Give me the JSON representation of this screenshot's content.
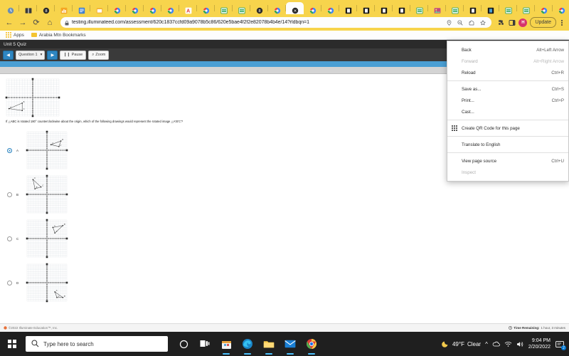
{
  "browser": {
    "tabs": [
      {
        "name": "tab-1",
        "icon": "clock-icon",
        "active": false
      },
      {
        "name": "tab-2",
        "icon": "book-icon",
        "active": false
      },
      {
        "name": "tab-3",
        "icon": "circle-8-icon",
        "active": false
      },
      {
        "name": "tab-4",
        "icon": "chart-icon",
        "active": false
      },
      {
        "name": "tab-5",
        "icon": "document-icon",
        "active": false
      },
      {
        "name": "tab-6",
        "icon": "window-icon",
        "active": false
      },
      {
        "name": "tab-7",
        "icon": "google-icon",
        "active": false
      },
      {
        "name": "tab-8",
        "icon": "google-icon",
        "active": false
      },
      {
        "name": "tab-9",
        "icon": "google-icon",
        "active": false
      },
      {
        "name": "tab-10",
        "icon": "google-icon",
        "active": false
      },
      {
        "name": "tab-11",
        "icon": "a-plus-icon",
        "active": false
      },
      {
        "name": "tab-12",
        "icon": "google-icon",
        "active": false
      },
      {
        "name": "tab-13",
        "icon": "spreadsheet-icon",
        "active": false
      },
      {
        "name": "tab-14",
        "icon": "spreadsheet-icon",
        "active": false
      },
      {
        "name": "tab-15",
        "icon": "circle-8-icon",
        "active": false
      },
      {
        "name": "tab-16",
        "icon": "google-icon",
        "active": false
      },
      {
        "name": "tab-17",
        "icon": "illuminate-icon",
        "active": true
      },
      {
        "name": "tab-18",
        "icon": "google-icon",
        "active": false
      },
      {
        "name": "tab-19",
        "icon": "google-icon",
        "active": false
      },
      {
        "name": "tab-20",
        "icon": "dark-doc-icon",
        "active": false
      },
      {
        "name": "tab-21",
        "icon": "dark-doc-icon",
        "active": false
      },
      {
        "name": "tab-22",
        "icon": "dark-doc-icon",
        "active": false
      },
      {
        "name": "tab-23",
        "icon": "dark-doc-icon",
        "active": false
      },
      {
        "name": "tab-24",
        "icon": "spreadsheet-icon",
        "active": false
      },
      {
        "name": "tab-25",
        "icon": "photo-icon",
        "active": false
      },
      {
        "name": "tab-26",
        "icon": "spreadsheet-icon",
        "active": false
      },
      {
        "name": "tab-27",
        "icon": "dark-doc-icon",
        "active": false
      },
      {
        "name": "tab-28",
        "icon": "blue-doc-icon",
        "active": false
      },
      {
        "name": "tab-29",
        "icon": "spreadsheet-icon",
        "active": false
      },
      {
        "name": "tab-30",
        "icon": "spreadsheet-icon",
        "active": false
      },
      {
        "name": "tab-31",
        "icon": "google-icon",
        "active": false
      },
      {
        "name": "tab-32",
        "icon": "google-icon",
        "active": false
      },
      {
        "name": "tab-33",
        "icon": "opera-icon",
        "active": false
      },
      {
        "name": "tab-34",
        "icon": "contact-icon",
        "active": false
      }
    ],
    "new_tab_label": "+",
    "tab_search_label": "⌄",
    "window_controls": {
      "minimize": "—",
      "maximize": "❐",
      "close": "✕"
    },
    "nav": {
      "back": "←",
      "forward": "→",
      "reload": "⟳",
      "home": "⌂"
    },
    "address": {
      "lock_icon": "lock-icon",
      "url": "testing.illuminateed.com/assessment/620c1837ccfd09a9078b5c86/620e5bae4f2f2e82078b4b4e/14?rldbqn=1"
    },
    "omni_icons": [
      "location-pin-icon",
      "zoom-out-icon",
      "share-icon",
      "bookmark-star-icon"
    ],
    "toolbar_right": {
      "extensions_icon": "puzzle-icon",
      "sidepanel_icon": "sidepanel-icon",
      "avatar_initial": "H",
      "update_label": "Update",
      "menu_icon": "kebab-menu-icon"
    },
    "bookmarks": [
      {
        "label": "Apps",
        "icon": "apps-grid-icon"
      },
      {
        "label": "Arabia Mtn Bookmarks",
        "icon": "folder-icon"
      }
    ],
    "theme_color": "#f7d44c"
  },
  "context_menu": {
    "groups": [
      [
        {
          "label": "Back",
          "accel": "Alt+Left Arrow",
          "disabled": false,
          "name": "ctx-back"
        },
        {
          "label": "Forward",
          "accel": "Alt+Right Arrow",
          "disabled": true,
          "name": "ctx-forward"
        },
        {
          "label": "Reload",
          "accel": "Ctrl+R",
          "disabled": false,
          "name": "ctx-reload"
        }
      ],
      [
        {
          "label": "Save as...",
          "accel": "Ctrl+S",
          "disabled": false,
          "name": "ctx-save-as"
        },
        {
          "label": "Print...",
          "accel": "Ctrl+P",
          "disabled": false,
          "name": "ctx-print"
        },
        {
          "label": "Cast...",
          "accel": "",
          "disabled": false,
          "name": "ctx-cast"
        }
      ],
      [
        {
          "label": "Create QR Code for this page",
          "accel": "",
          "disabled": false,
          "name": "ctx-qr-code",
          "icon": "qr-code-icon"
        }
      ],
      [
        {
          "label": "Translate to English",
          "accel": "",
          "disabled": false,
          "name": "ctx-translate"
        }
      ],
      [
        {
          "label": "View page source",
          "accel": "Ctrl+U",
          "disabled": false,
          "name": "ctx-view-source"
        },
        {
          "label": "Inspect",
          "accel": "",
          "disabled": true,
          "name": "ctx-inspect"
        }
      ]
    ]
  },
  "quiz": {
    "title": "Unit 5 Quiz",
    "toolbar": {
      "prev_label": "◀",
      "next_label": "▶",
      "question_select": "Question 1",
      "pause_label": "Pause",
      "zoom_label": "Zoom",
      "pause_icon": "pause-icon",
      "zoom_icon": "magnifier-icon",
      "chevron_icon": "chevron-down-icon"
    },
    "stem": "If △ABC is rotated 180° counterclockwise about the origin, which of the following drawings would represent the rotated image △A'B'C'?",
    "choices": [
      {
        "letter": "A",
        "selected": true,
        "name": "choice-a"
      },
      {
        "letter": "B",
        "selected": false,
        "name": "choice-b"
      },
      {
        "letter": "C",
        "selected": false,
        "name": "choice-c"
      },
      {
        "letter": "D",
        "selected": false,
        "name": "choice-d"
      }
    ],
    "footer": {
      "copyright": "©2022 Illuminate Education™, Inc.",
      "time_remaining_label": "Time Remaining:",
      "time_remaining_value": "1 hour, 3 minutes",
      "clock_icon": "clock-icon"
    }
  },
  "graphs": {
    "stem_graph": {
      "xlim": [
        -10,
        10
      ],
      "ylim": [
        -10,
        10
      ],
      "points": [
        {
          "label": "A",
          "x": -9,
          "y": -6
        },
        {
          "label": "B",
          "x": -4,
          "y": -3
        },
        {
          "label": "C",
          "x": -4,
          "y": -7
        }
      ]
    },
    "choice_graphs": [
      {
        "points": [
          {
            "label": "A'",
            "x": 2,
            "y": 3
          },
          {
            "label": "B'",
            "x": 7,
            "y": 5
          },
          {
            "label": "C'",
            "x": 6,
            "y": 2
          }
        ]
      },
      {
        "points": [
          {
            "label": "A'",
            "x": -7,
            "y": 8
          },
          {
            "label": "B'",
            "x": -6,
            "y": 3
          },
          {
            "label": "C'",
            "x": -3,
            "y": 4
          }
        ]
      },
      {
        "points": [
          {
            "label": "A'",
            "x": 3,
            "y": 6
          },
          {
            "label": "B'",
            "x": 8,
            "y": 7
          },
          {
            "label": "C'",
            "x": 4,
            "y": 3
          }
        ]
      },
      {
        "points": [
          {
            "label": "A'",
            "x": 4,
            "y": -5
          },
          {
            "label": "B'",
            "x": 8,
            "y": -8
          },
          {
            "label": "C'",
            "x": 5,
            "y": -8
          }
        ]
      }
    ]
  },
  "taskbar": {
    "search_placeholder": "Type here to search",
    "search_icon": "search-icon",
    "start_icon": "windows-logo-icon",
    "apps": [
      {
        "name": "cortana-icon"
      },
      {
        "name": "task-view-icon"
      },
      {
        "name": "store-icon"
      },
      {
        "name": "edge-icon"
      },
      {
        "name": "file-explorer-icon"
      },
      {
        "name": "mail-icon"
      },
      {
        "name": "chrome-icon"
      },
      {
        "name": "orange-app-icon"
      },
      {
        "name": "teal-app-icon"
      },
      {
        "name": "blue-app-icon"
      },
      {
        "name": "red-app-icon"
      }
    ],
    "weather": {
      "temp": "49°F",
      "condition": "Clear",
      "icon": "moon-icon"
    },
    "tray_icons": [
      "chevron-up-icon",
      "onedrive-icon",
      "network-icon",
      "volume-icon"
    ],
    "clock": {
      "time": "9:04 PM",
      "date": "2/20/2022"
    },
    "notifications": {
      "icon": "notification-icon",
      "count": "2"
    }
  }
}
